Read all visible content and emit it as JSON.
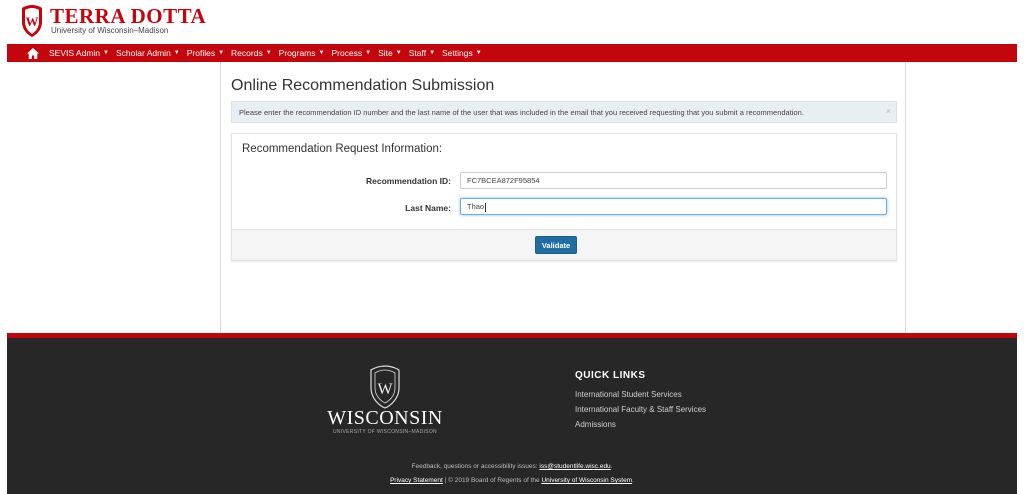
{
  "header": {
    "brand_title": "TERRA DOTTA",
    "brand_subtitle": "University of Wisconsin–Madison"
  },
  "nav": {
    "items": [
      {
        "label": "SEVIS Admin"
      },
      {
        "label": "Scholar Admin"
      },
      {
        "label": "Profiles"
      },
      {
        "label": "Records"
      },
      {
        "label": "Programs"
      },
      {
        "label": "Process"
      },
      {
        "label": "Site"
      },
      {
        "label": "Staff"
      },
      {
        "label": "Settings"
      }
    ]
  },
  "main": {
    "page_title": "Online Recommendation Submission",
    "alert_text": "Please enter the recommendation ID number and the last name of the user that was included in the email that you received requesting that you submit a recommendation.",
    "alert_close": "×",
    "panel_title": "Recommendation Request Information:",
    "fields": [
      {
        "label": "Recommendation ID:",
        "value": "FC7BCEA872F95854"
      },
      {
        "label": "Last Name:",
        "value": "Thao"
      }
    ],
    "validate_label": "Validate"
  },
  "footer": {
    "wordmark": "WISCONSIN",
    "wordmark_sub": "UNIVERSITY OF WISCONSIN–MADISON",
    "quick_links_title": "QUICK LINKS",
    "quick_links": [
      "International Student Services",
      "International Faculty & Staff Services",
      "Admissions"
    ],
    "feedback_prefix": "Feedback, questions or accessibility issues: ",
    "feedback_email": "iss@studentlife.wisc.edu",
    "feedback_suffix": ".",
    "privacy_label": "Privacy Statement",
    "copyright_mid": " | © 2019 Board of Regents of the ",
    "university_link": "University of Wisconsin System",
    "copyright_end": "."
  },
  "colors": {
    "brand_red": "#c5050c",
    "footer_bg": "#282728",
    "button_blue": "#1f6da1"
  }
}
